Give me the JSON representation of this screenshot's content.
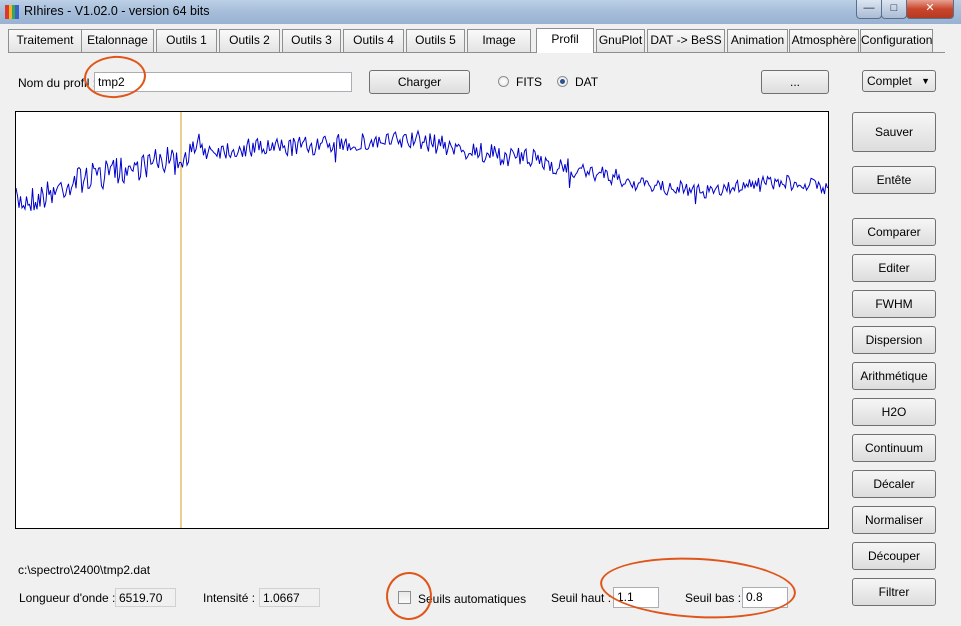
{
  "window": {
    "title": "RIhires - V1.02.0 - version 64 bits"
  },
  "tabs": [
    {
      "label": "Traitement",
      "active": false
    },
    {
      "label": "Etalonnage",
      "active": false
    },
    {
      "label": "Outils 1",
      "active": false
    },
    {
      "label": "Outils 2",
      "active": false
    },
    {
      "label": "Outils 3",
      "active": false
    },
    {
      "label": "Outils 4",
      "active": false
    },
    {
      "label": "Outils 5",
      "active": false
    },
    {
      "label": "Image",
      "active": false
    },
    {
      "label": "Profil",
      "active": true
    },
    {
      "label": "GnuPlot",
      "active": false
    },
    {
      "label": "DAT -> BeSS",
      "active": false
    },
    {
      "label": "Animation",
      "active": false
    },
    {
      "label": "Atmosphère",
      "active": false
    },
    {
      "label": "Configuration",
      "active": false
    }
  ],
  "profile": {
    "name_label": "Nom du profil :",
    "name_value": "tmp2",
    "load_button": "Charger",
    "format_options": [
      {
        "label": "FITS",
        "selected": false
      },
      {
        "label": "DAT",
        "selected": true
      }
    ],
    "browse_button": "...",
    "mode_select": "Complet"
  },
  "side_buttons": [
    "Sauver",
    "Entête",
    "Comparer",
    "Editer",
    "FWHM",
    "Dispersion",
    "Arithmétique",
    "H2O",
    "Continuum",
    "Décaler",
    "Normaliser",
    "Découper",
    "Filtrer"
  ],
  "status": {
    "file_path": "c:\\spectro\\2400\\tmp2.dat",
    "wavelength_label": "Longueur d'onde :",
    "wavelength_value": "6519.70",
    "intensity_label": "Intensité :",
    "intensity_value": "1.0667",
    "auto_threshold_label": "Seuils automatiques",
    "auto_threshold_checked": false,
    "high_threshold_label": "Seuil haut :",
    "high_threshold_value": "1.1",
    "low_threshold_label": "Seuil bas :",
    "low_threshold_value": "0.8"
  },
  "colors": {
    "spectrum": "#0000cc",
    "cursor": "#d4a020",
    "annotation": "#e0561a"
  }
}
